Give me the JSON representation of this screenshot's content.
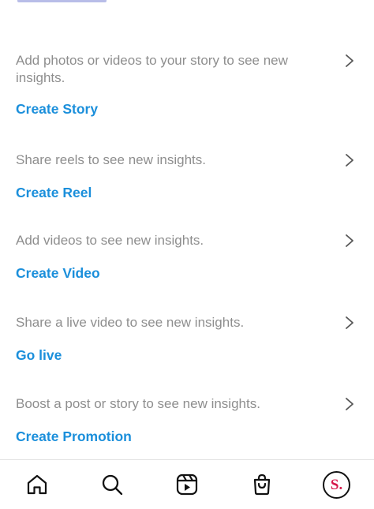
{
  "sections": [
    {
      "desc": "Add photos or videos to your story to see new insights.",
      "action": "Create Story"
    },
    {
      "desc": "Share reels to see new insights.",
      "action": "Create Reel"
    },
    {
      "desc": "Add videos to see new insights.",
      "action": "Create Video"
    },
    {
      "desc": "Share a live video to see new insights.",
      "action": "Go live"
    },
    {
      "desc": "Boost a post or story to see new insights.",
      "action": "Create Promotion"
    }
  ],
  "nav": {
    "items": [
      "home-icon",
      "search-icon",
      "reels-icon",
      "shop-icon",
      "profile-avatar"
    ],
    "avatar_letter": "S."
  },
  "colors": {
    "action": "#1b8fdb",
    "desc": "#8e8e8e",
    "avatar": "#d6194b"
  }
}
